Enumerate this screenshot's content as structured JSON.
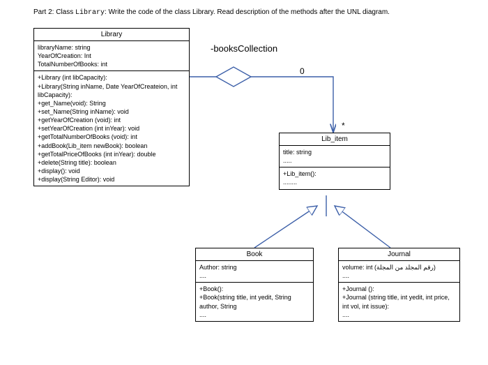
{
  "heading": {
    "prefix": "Part 2: Class ",
    "classname": "Library",
    "rest": ": Write the code of the class Library. Read description of the methods after the UNL diagram."
  },
  "association": {
    "label": "-booksCollection",
    "mult_library": "0",
    "mult_libitem": "*"
  },
  "classes": {
    "library": {
      "name": "Library",
      "attrs": [
        "libraryName: string",
        "YearOfCreation: Int",
        "TotalNumberOfBooks: int"
      ],
      "ops": [
        "+Library (int libCapacity):",
        "+Library(String inName, Date YearOfCreateion, int libCapacity):",
        "+get_Name(void): String",
        "+set_Name(String inName): void",
        "+getYearOfCreation (void): int",
        "+setYearOfCreation (int inYear): void",
        "+getTotalNumberOfBooks (void): int",
        "+addBook(Lib_item newBook): boolean",
        "+getTotalPriceOfBooks (int inYear): double",
        "+delete(String title): boolean",
        "+display(): void",
        "+display(String Editor): void"
      ]
    },
    "libitem": {
      "name": "Lib_item",
      "attrs": [
        "title: string",
        "....."
      ],
      "ops": [
        "+Lib_item():",
        "........"
      ]
    },
    "book": {
      "name": "Book",
      "attrs": [
        "Author: string",
        "...."
      ],
      "ops": [
        "+Book():",
        "+Book(string title, int yedit, String author, String",
        "...."
      ]
    },
    "journal": {
      "name": "Journal",
      "attrs": [
        "volume: int (رقم المجلد من المجلة)",
        "...."
      ],
      "ops": [
        "+Journal ():",
        "+Journal (string title, int yedit, int price, int vol, int issue):",
        "...."
      ]
    }
  },
  "chart_data": {
    "type": "uml-class-diagram",
    "classes": [
      {
        "name": "Library",
        "attrs": [
          "libraryName: string",
          "YearOfCreation: Int",
          "TotalNumberOfBooks: int"
        ],
        "ops": [
          "+Library (int libCapacity)",
          "+Library(String inName, Date YearOfCreateion, int libCapacity)",
          "+get_Name(void): String",
          "+set_Name(String inName): void",
          "+getYearOfCreation (void): int",
          "+setYearOfCreation (int inYear): void",
          "+getTotalNumberOfBooks (void): int",
          "+addBook(Lib_item newBook): boolean",
          "+getTotalPriceOfBooks (int inYear): double",
          "+delete(String title): boolean",
          "+display(): void",
          "+display(String Editor): void"
        ]
      },
      {
        "name": "Lib_item",
        "attrs": [
          "title: string"
        ],
        "ops": [
          "+Lib_item()"
        ]
      },
      {
        "name": "Book",
        "attrs": [
          "Author: string"
        ],
        "ops": [
          "+Book()",
          "+Book(string title, int yedit, String author, String"
        ]
      },
      {
        "name": "Journal",
        "attrs": [
          "volume: int"
        ],
        "ops": [
          "+Journal()",
          "+Journal(string title, int yedit, int price, int vol, int issue)"
        ]
      }
    ],
    "relations": [
      {
        "type": "aggregation",
        "from": "Library",
        "to": "Lib_item",
        "label": "-booksCollection",
        "mult_from": "0",
        "mult_to": "*"
      },
      {
        "type": "generalization",
        "parent": "Lib_item",
        "child": "Book"
      },
      {
        "type": "generalization",
        "parent": "Lib_item",
        "child": "Journal"
      }
    ]
  }
}
